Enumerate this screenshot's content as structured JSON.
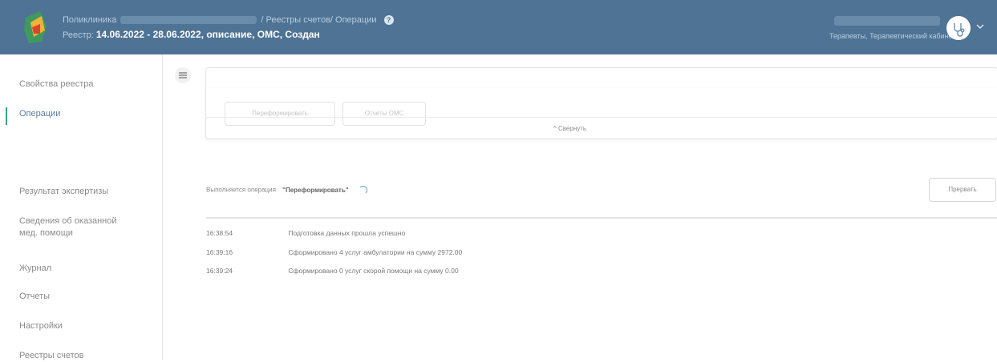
{
  "header": {
    "app_name": "Поликлиника",
    "breadcrumb": "/ Реестры счетов/ Операции",
    "registry_prefix": "Реестр:",
    "registry_info": "14.06.2022 - 28.06.2022, описание, ОМС, Создан",
    "user_role": "Терапевты, Терапевтический кабинет",
    "help_icon": "question-circle-icon",
    "avatar_icon": "stethoscope-icon",
    "chevron_icon": "chevron-down-icon"
  },
  "colors": {
    "header_bg": "#4f7394",
    "active_bar": "#3aa88a",
    "spinner": "#5aa8d8"
  },
  "sidebar": {
    "items": [
      {
        "label": "Свойства реестра"
      },
      {
        "label": "Операции"
      },
      {
        "label": "Результат экспертизы"
      },
      {
        "label": "Сведения об оказанной"
      },
      {
        "label": "мед. помощи"
      },
      {
        "label": "Журнал"
      },
      {
        "label": "Отчеты"
      },
      {
        "label": "Настройки"
      },
      {
        "label": "Реестры счетов"
      }
    ]
  },
  "actions": {
    "reform_label": "Переформировать",
    "reports_label": "Отчеты ОМС",
    "collapse_label": "^ Свернуть"
  },
  "operation": {
    "status_label": "Выполняется операция",
    "name": "\"Переформировать\"",
    "stop_label": "Прервать"
  },
  "log": [
    {
      "time": "16:38:54",
      "message": "Подготовка данных прошла успешно"
    },
    {
      "time": "16:39:16",
      "message": "Сформировано 4 услуг амбулатории на сумму 2972.00"
    },
    {
      "time": "16:39:24",
      "message": "Сформировано 0 услуг скорой помощи на сумму 0.00"
    }
  ]
}
